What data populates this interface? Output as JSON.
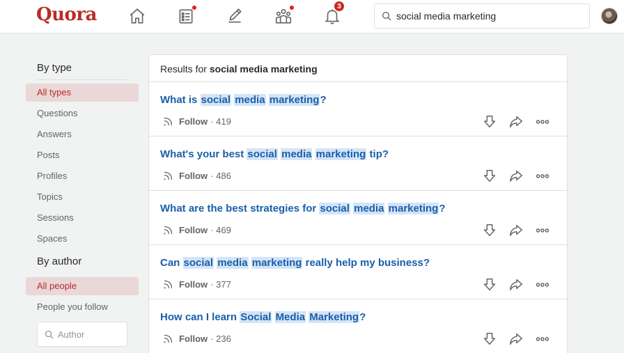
{
  "header": {
    "logo": "Quora",
    "notifications_count": "3",
    "search_value": "social media marketing",
    "accent": "#b92b27"
  },
  "sidebar": {
    "by_type_heading": "By type",
    "type_items": [
      "All types",
      "Questions",
      "Answers",
      "Posts",
      "Profiles",
      "Topics",
      "Sessions",
      "Spaces"
    ],
    "by_author_heading": "By author",
    "author_items": [
      "All people",
      "People you follow"
    ],
    "author_placeholder": "Author"
  },
  "results": {
    "prefix": "Results for",
    "query": "social media marketing",
    "follow_label": "Follow",
    "items": [
      {
        "parts": [
          [
            "What is ",
            false
          ],
          [
            "social",
            true
          ],
          [
            " ",
            false
          ],
          [
            "media",
            true
          ],
          [
            " ",
            false
          ],
          [
            "marketing",
            true
          ],
          [
            "?",
            false
          ]
        ],
        "follow_count": "· 419"
      },
      {
        "parts": [
          [
            "What's your best ",
            false
          ],
          [
            "social",
            true
          ],
          [
            " ",
            false
          ],
          [
            "media",
            true
          ],
          [
            " ",
            false
          ],
          [
            "marketing",
            true
          ],
          [
            " tip?",
            false
          ]
        ],
        "follow_count": "· 486"
      },
      {
        "parts": [
          [
            "What are the best strategies for ",
            false
          ],
          [
            "social",
            true
          ],
          [
            " ",
            false
          ],
          [
            "media",
            true
          ],
          [
            " ",
            false
          ],
          [
            "marketing",
            true
          ],
          [
            "?",
            false
          ]
        ],
        "follow_count": "· 469"
      },
      {
        "parts": [
          [
            "Can ",
            false
          ],
          [
            "social",
            true
          ],
          [
            " ",
            false
          ],
          [
            "media",
            true
          ],
          [
            " ",
            false
          ],
          [
            "marketing",
            true
          ],
          [
            " really help my business?",
            false
          ]
        ],
        "follow_count": "· 377"
      },
      {
        "parts": [
          [
            "How can I learn ",
            false
          ],
          [
            "Social",
            true
          ],
          [
            " ",
            false
          ],
          [
            "Media",
            true
          ],
          [
            " ",
            false
          ],
          [
            "Marketing",
            true
          ],
          [
            "?",
            false
          ]
        ],
        "follow_count": "· 236"
      }
    ]
  }
}
